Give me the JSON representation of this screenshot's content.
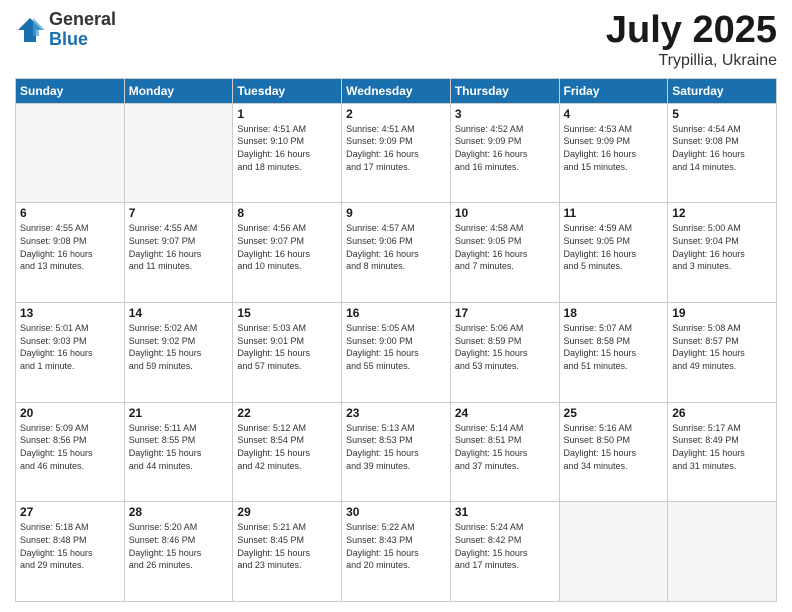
{
  "header": {
    "logo_general": "General",
    "logo_blue": "Blue",
    "title": "July 2025",
    "location": "Trypillia, Ukraine"
  },
  "weekdays": [
    "Sunday",
    "Monday",
    "Tuesday",
    "Wednesday",
    "Thursday",
    "Friday",
    "Saturday"
  ],
  "weeks": [
    [
      {
        "day": "",
        "info": ""
      },
      {
        "day": "",
        "info": ""
      },
      {
        "day": "1",
        "info": "Sunrise: 4:51 AM\nSunset: 9:10 PM\nDaylight: 16 hours\nand 18 minutes."
      },
      {
        "day": "2",
        "info": "Sunrise: 4:51 AM\nSunset: 9:09 PM\nDaylight: 16 hours\nand 17 minutes."
      },
      {
        "day": "3",
        "info": "Sunrise: 4:52 AM\nSunset: 9:09 PM\nDaylight: 16 hours\nand 16 minutes."
      },
      {
        "day": "4",
        "info": "Sunrise: 4:53 AM\nSunset: 9:09 PM\nDaylight: 16 hours\nand 15 minutes."
      },
      {
        "day": "5",
        "info": "Sunrise: 4:54 AM\nSunset: 9:08 PM\nDaylight: 16 hours\nand 14 minutes."
      }
    ],
    [
      {
        "day": "6",
        "info": "Sunrise: 4:55 AM\nSunset: 9:08 PM\nDaylight: 16 hours\nand 13 minutes."
      },
      {
        "day": "7",
        "info": "Sunrise: 4:55 AM\nSunset: 9:07 PM\nDaylight: 16 hours\nand 11 minutes."
      },
      {
        "day": "8",
        "info": "Sunrise: 4:56 AM\nSunset: 9:07 PM\nDaylight: 16 hours\nand 10 minutes."
      },
      {
        "day": "9",
        "info": "Sunrise: 4:57 AM\nSunset: 9:06 PM\nDaylight: 16 hours\nand 8 minutes."
      },
      {
        "day": "10",
        "info": "Sunrise: 4:58 AM\nSunset: 9:05 PM\nDaylight: 16 hours\nand 7 minutes."
      },
      {
        "day": "11",
        "info": "Sunrise: 4:59 AM\nSunset: 9:05 PM\nDaylight: 16 hours\nand 5 minutes."
      },
      {
        "day": "12",
        "info": "Sunrise: 5:00 AM\nSunset: 9:04 PM\nDaylight: 16 hours\nand 3 minutes."
      }
    ],
    [
      {
        "day": "13",
        "info": "Sunrise: 5:01 AM\nSunset: 9:03 PM\nDaylight: 16 hours\nand 1 minute."
      },
      {
        "day": "14",
        "info": "Sunrise: 5:02 AM\nSunset: 9:02 PM\nDaylight: 15 hours\nand 59 minutes."
      },
      {
        "day": "15",
        "info": "Sunrise: 5:03 AM\nSunset: 9:01 PM\nDaylight: 15 hours\nand 57 minutes."
      },
      {
        "day": "16",
        "info": "Sunrise: 5:05 AM\nSunset: 9:00 PM\nDaylight: 15 hours\nand 55 minutes."
      },
      {
        "day": "17",
        "info": "Sunrise: 5:06 AM\nSunset: 8:59 PM\nDaylight: 15 hours\nand 53 minutes."
      },
      {
        "day": "18",
        "info": "Sunrise: 5:07 AM\nSunset: 8:58 PM\nDaylight: 15 hours\nand 51 minutes."
      },
      {
        "day": "19",
        "info": "Sunrise: 5:08 AM\nSunset: 8:57 PM\nDaylight: 15 hours\nand 49 minutes."
      }
    ],
    [
      {
        "day": "20",
        "info": "Sunrise: 5:09 AM\nSunset: 8:56 PM\nDaylight: 15 hours\nand 46 minutes."
      },
      {
        "day": "21",
        "info": "Sunrise: 5:11 AM\nSunset: 8:55 PM\nDaylight: 15 hours\nand 44 minutes."
      },
      {
        "day": "22",
        "info": "Sunrise: 5:12 AM\nSunset: 8:54 PM\nDaylight: 15 hours\nand 42 minutes."
      },
      {
        "day": "23",
        "info": "Sunrise: 5:13 AM\nSunset: 8:53 PM\nDaylight: 15 hours\nand 39 minutes."
      },
      {
        "day": "24",
        "info": "Sunrise: 5:14 AM\nSunset: 8:51 PM\nDaylight: 15 hours\nand 37 minutes."
      },
      {
        "day": "25",
        "info": "Sunrise: 5:16 AM\nSunset: 8:50 PM\nDaylight: 15 hours\nand 34 minutes."
      },
      {
        "day": "26",
        "info": "Sunrise: 5:17 AM\nSunset: 8:49 PM\nDaylight: 15 hours\nand 31 minutes."
      }
    ],
    [
      {
        "day": "27",
        "info": "Sunrise: 5:18 AM\nSunset: 8:48 PM\nDaylight: 15 hours\nand 29 minutes."
      },
      {
        "day": "28",
        "info": "Sunrise: 5:20 AM\nSunset: 8:46 PM\nDaylight: 15 hours\nand 26 minutes."
      },
      {
        "day": "29",
        "info": "Sunrise: 5:21 AM\nSunset: 8:45 PM\nDaylight: 15 hours\nand 23 minutes."
      },
      {
        "day": "30",
        "info": "Sunrise: 5:22 AM\nSunset: 8:43 PM\nDaylight: 15 hours\nand 20 minutes."
      },
      {
        "day": "31",
        "info": "Sunrise: 5:24 AM\nSunset: 8:42 PM\nDaylight: 15 hours\nand 17 minutes."
      },
      {
        "day": "",
        "info": ""
      },
      {
        "day": "",
        "info": ""
      }
    ]
  ]
}
